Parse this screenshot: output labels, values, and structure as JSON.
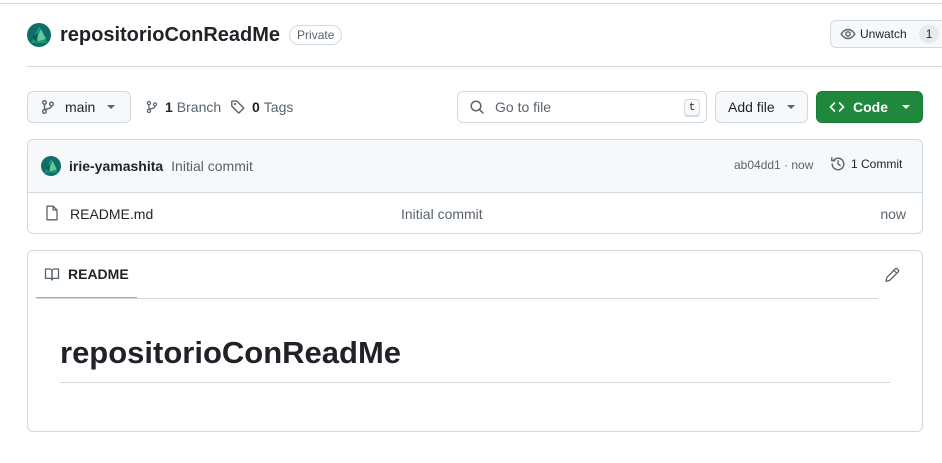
{
  "repo": {
    "name": "repositorioConReadMe",
    "visibility": "Private",
    "watch_label": "Unwatch",
    "watch_count": "1"
  },
  "toolbar": {
    "branch": "main",
    "branch_count": "1",
    "branch_label": "Branch",
    "tag_count": "0",
    "tag_label": "Tags",
    "goto_placeholder": "Go to file",
    "goto_shortcut": "t",
    "add_file_label": "Add file",
    "code_label": "Code"
  },
  "latest_commit": {
    "author": "irie-yamashita",
    "message": "Initial commit",
    "hash_time": "ab04dd1 · now",
    "commit_count_label": "1 Commit"
  },
  "files": [
    {
      "name": "README.md",
      "message": "Initial commit",
      "time": "now"
    }
  ],
  "readme": {
    "tab_label": "README",
    "heading": "repositorioConReadMe"
  },
  "colors": {
    "primary_button": "#1f883d",
    "tab_underline": "#fd8c73",
    "border": "#d1d9e0",
    "muted_text": "#59636e"
  },
  "icons": [
    "eye-icon",
    "git-branch-icon",
    "tag-icon",
    "search-icon",
    "code-icon",
    "history-icon",
    "file-icon",
    "book-icon",
    "pencil-icon"
  ]
}
